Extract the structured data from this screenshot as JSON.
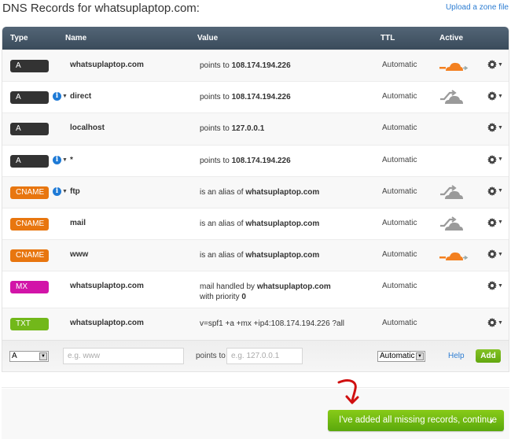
{
  "header": {
    "title": "DNS Records for whatsuplaptop.com:",
    "upload_link": "Upload a zone file"
  },
  "columns": {
    "type": "Type",
    "name": "Name",
    "value": "Value",
    "ttl": "TTL",
    "active": "Active"
  },
  "type_colors": {
    "A": "#333333",
    "CNAME": "#e8760f",
    "MX": "#d214a8",
    "TXT": "#72b81a"
  },
  "records": [
    {
      "type": "A",
      "info": false,
      "name": "whatsuplaptop.com",
      "value_prefix": "points to ",
      "value_bold": "108.174.194.226",
      "value_line2_prefix": "",
      "value_line2_bold": "",
      "ttl": "Automatic",
      "cloud": "orange"
    },
    {
      "type": "A",
      "info": true,
      "name": "direct",
      "value_prefix": "points to ",
      "value_bold": "108.174.194.226",
      "value_line2_prefix": "",
      "value_line2_bold": "",
      "ttl": "Automatic",
      "cloud": "gray"
    },
    {
      "type": "A",
      "info": false,
      "name": "localhost",
      "value_prefix": "points to ",
      "value_bold": "127.0.0.1",
      "value_line2_prefix": "",
      "value_line2_bold": "",
      "ttl": "Automatic",
      "cloud": "none"
    },
    {
      "type": "A",
      "info": true,
      "name": "*",
      "value_prefix": "points to ",
      "value_bold": "108.174.194.226",
      "value_line2_prefix": "",
      "value_line2_bold": "",
      "ttl": "Automatic",
      "cloud": "none"
    },
    {
      "type": "CNAME",
      "info": true,
      "name": "ftp",
      "value_prefix": "is an alias of ",
      "value_bold": "whatsuplaptop.com",
      "value_line2_prefix": "",
      "value_line2_bold": "",
      "ttl": "Automatic",
      "cloud": "gray"
    },
    {
      "type": "CNAME",
      "info": false,
      "name": "mail",
      "value_prefix": "is an alias of ",
      "value_bold": "whatsuplaptop.com",
      "value_line2_prefix": "",
      "value_line2_bold": "",
      "ttl": "Automatic",
      "cloud": "gray"
    },
    {
      "type": "CNAME",
      "info": false,
      "name": "www",
      "value_prefix": "is an alias of ",
      "value_bold": "whatsuplaptop.com",
      "value_line2_prefix": "",
      "value_line2_bold": "",
      "ttl": "Automatic",
      "cloud": "orange"
    },
    {
      "type": "MX",
      "info": false,
      "name": "whatsuplaptop.com",
      "value_prefix": "mail handled by ",
      "value_bold": "whatsuplaptop.com",
      "value_line2_prefix": "with priority ",
      "value_line2_bold": "0",
      "ttl": "Automatic",
      "cloud": "none"
    },
    {
      "type": "TXT",
      "info": false,
      "name": "whatsuplaptop.com",
      "value_prefix": "v=spf1 +a +mx +ip4:108.174.194.226 ?all",
      "value_bold": "",
      "value_line2_prefix": "",
      "value_line2_bold": "",
      "ttl": "Automatic",
      "cloud": "none"
    }
  ],
  "add_form": {
    "type_value": "A",
    "name_placeholder": "e.g. www",
    "points_to_label": "points to",
    "value_placeholder": "e.g. 127.0.0.1",
    "ttl_value": "Automatic",
    "help_label": "Help",
    "add_label": "Add"
  },
  "footer": {
    "continue_label": "I've added all missing records, continue",
    "continue_chevron": "›"
  }
}
